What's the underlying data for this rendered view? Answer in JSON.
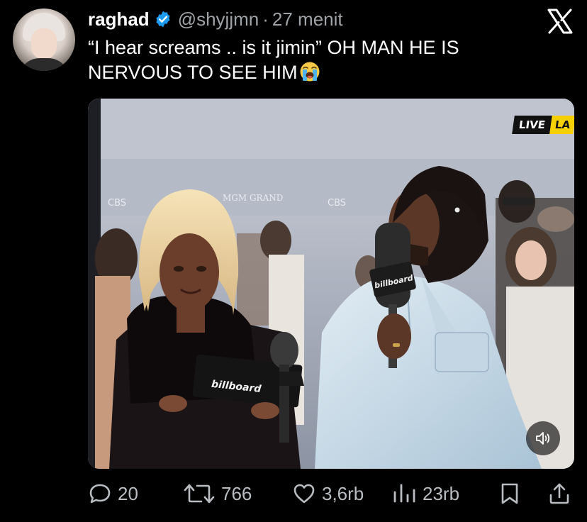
{
  "tweet": {
    "display_name": "raghad",
    "handle": "@shyjjmn",
    "separator": "·",
    "time": "27 menit",
    "text": "“I hear screams .. is it jimin” OH MAN HE IS NERVOUS TO SEE HIM",
    "emoji": "loudly-crying-face"
  },
  "media": {
    "live_badge_text": "LIVE",
    "live_badge_partial": "LA",
    "mic_flag_text": "billboard",
    "card_text": "billboard",
    "backdrop_logo_1": "CBS",
    "backdrop_logo_2": "MGM GRAND",
    "backdrop_logo_3": "CBS"
  },
  "actions": {
    "replies": "20",
    "retweets": "766",
    "likes": "3,6rb",
    "views": "23rb"
  },
  "colors": {
    "background": "#000000",
    "verified": "#1d9bf0",
    "text": "#ffffff",
    "muted": "#a0a4a8"
  },
  "icons": [
    "x-logo-icon",
    "verified-badge-icon",
    "reply-icon",
    "retweet-icon",
    "like-icon",
    "views-icon",
    "bookmark-icon",
    "share-icon",
    "volume-icon"
  ]
}
